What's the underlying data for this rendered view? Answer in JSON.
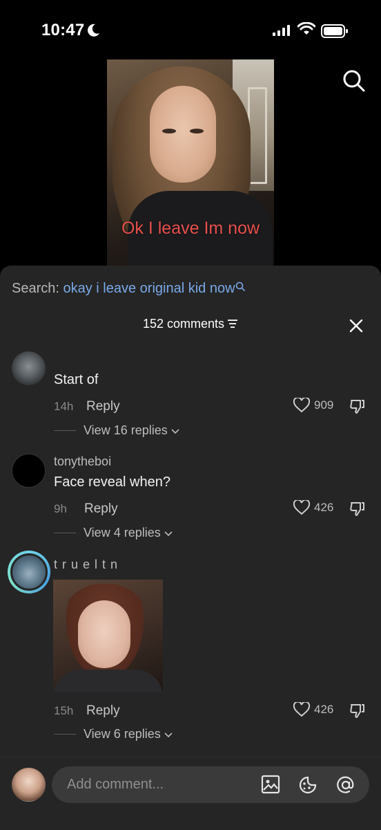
{
  "status_bar": {
    "time": "10:47"
  },
  "video": {
    "caption": "Ok I leave Im now"
  },
  "search": {
    "label": "Search: ",
    "query": "okay i leave original kid now"
  },
  "comments_header": {
    "count_label": "152 comments"
  },
  "comments": [
    {
      "username": "",
      "text": "Start of",
      "age": "14h",
      "reply_label": "Reply",
      "likes": "909",
      "view_replies": "View 16 replies"
    },
    {
      "username": "tonytheboi",
      "text": "Face reveal when?",
      "age": "9h",
      "reply_label": "Reply",
      "likes": "426",
      "view_replies": "View 4 replies"
    },
    {
      "username": "t r u e l t n",
      "text": "",
      "age": "15h",
      "reply_label": "Reply",
      "likes": "426",
      "view_replies": "View 6 replies"
    }
  ],
  "composer": {
    "placeholder": "Add comment..."
  },
  "colors": {
    "accent_link": "#7aa9e8",
    "caption_red": "#e8504c",
    "sheet_bg": "#252525"
  },
  "icons": [
    "moon-icon",
    "signal-icon",
    "wifi-icon",
    "battery-icon",
    "search-icon",
    "filter-icon",
    "close-icon",
    "heart-icon",
    "dislike-icon",
    "chevron-down-icon",
    "image-icon",
    "emoji-icon",
    "at-icon"
  ]
}
